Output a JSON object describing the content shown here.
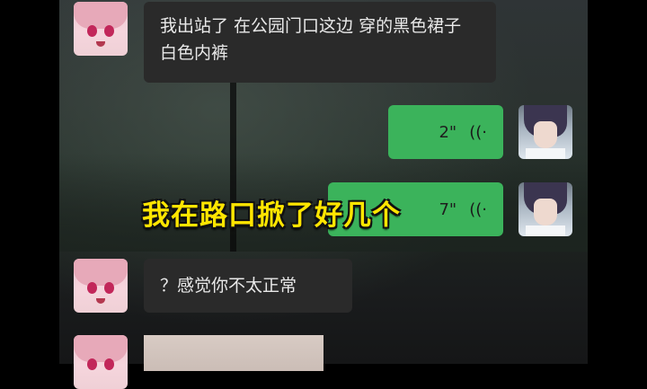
{
  "messages": [
    {
      "from": "other",
      "type": "text",
      "text": "我出站了 在公园门口这边 穿的黑色裙子 白色内裤",
      "avatar": "anime-girl-avatar"
    },
    {
      "from": "self",
      "type": "voice",
      "duration": "2\"",
      "avatar": "anime-boy-avatar"
    },
    {
      "from": "self",
      "type": "voice",
      "duration": "7\"",
      "avatar": "anime-boy-avatar"
    },
    {
      "from": "other",
      "type": "text",
      "text": "？感觉你不太正常",
      "avatar": "anime-girl-avatar"
    },
    {
      "from": "other",
      "type": "image",
      "avatar": "anime-girl-avatar"
    }
  ],
  "subtitle": "我在路口掀了好几个",
  "colors": {
    "incoming_bubble": "#2a2a2a",
    "outgoing_bubble": "#3bb35b",
    "subtitle": "#ffe600"
  }
}
